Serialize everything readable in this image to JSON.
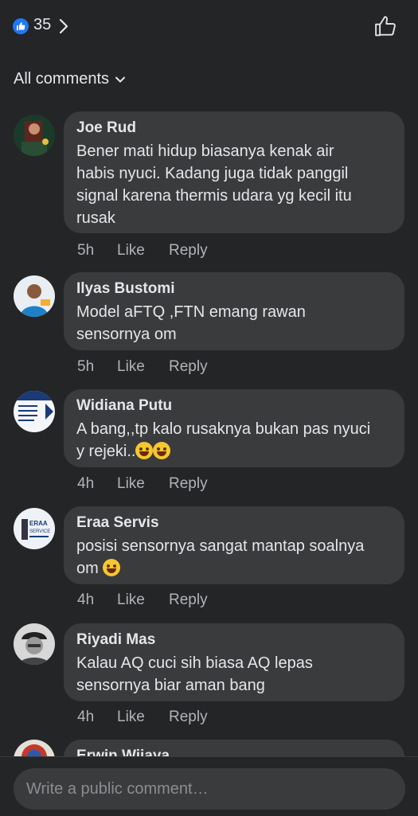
{
  "header": {
    "reaction_count": "35"
  },
  "filter": {
    "label": "All comments"
  },
  "comments": [
    {
      "name": "Joe Rud",
      "lines": [
        "Bener mati hidup biasanya kenak air",
        "habis nyuci. Kadang juga tidak panggil",
        "signal karena thermis udara yg kecil itu",
        "rusak"
      ],
      "time": "5h",
      "like": "Like",
      "reply": "Reply"
    },
    {
      "name": "Ilyas Bustomi",
      "lines": [
        "Model aFTQ  ,FTN emang rawan",
        "sensornya om"
      ],
      "time": "5h",
      "like": "Like",
      "reply": "Reply"
    },
    {
      "name": "Widiana Putu",
      "lines": [
        "A bang,,tp kalo rusaknya bukan pas nyuci",
        "y rejeki.."
      ],
      "time": "4h",
      "like": "Like",
      "reply": "Reply"
    },
    {
      "name": "Eraa Servis",
      "lines": [
        "posisi sensornya sangat mantap soalnya",
        "om"
      ],
      "time": "4h",
      "like": "Like",
      "reply": "Reply"
    },
    {
      "name": "Riyadi Mas",
      "lines": [
        "Kalau AQ cuci sih biasa AQ lepas",
        "sensornya biar aman bang"
      ],
      "time": "4h",
      "like": "Like",
      "reply": "Reply"
    },
    {
      "name": "Erwin Wijaya"
    }
  ],
  "composer": {
    "placeholder": "Write a public comment…"
  },
  "avatar_logos": {
    "eraa_line1": "ERAA",
    "eraa_line2": "SERVICE"
  },
  "colors": {
    "background": "#242526",
    "bubble": "#3a3b3c",
    "accent": "#2078f4",
    "muted_text": "#b0b3b8"
  }
}
